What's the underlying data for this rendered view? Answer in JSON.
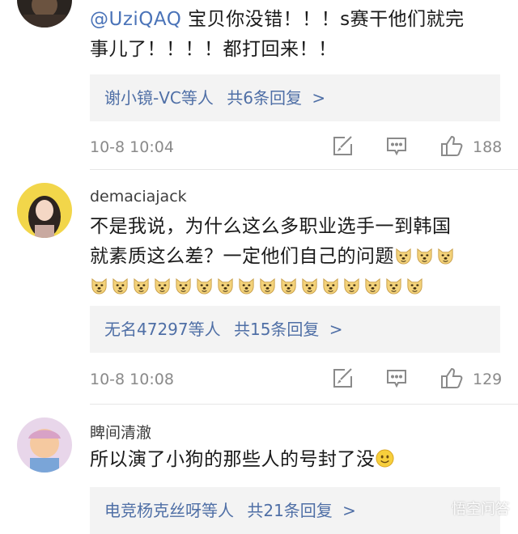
{
  "comments": [
    {
      "mention": "@UziQAQ",
      "text_line1_rest": " 宝贝你没错！！！s赛干他们就完",
      "text_line2": "事儿了！！！！都打回来！！",
      "replies": {
        "users": "谢小镜-VC等人",
        "total": "共6条回复",
        "chevron": ">"
      },
      "timestamp": "10-8 10:04",
      "likes": "188"
    },
    {
      "username": "demaciajack",
      "text_line1": "不是我说，为什么这么多职业选手一到韩国",
      "text_line2": "就素质这么差？一定他们自己的问题",
      "replies": {
        "users": "无名47297等人",
        "total": "共15条回复",
        "chevron": ">"
      },
      "timestamp": "10-8 10:08",
      "likes": "129"
    },
    {
      "username": "睥间清澈",
      "text_line1": "所以演了小狗的那些人的号封了没",
      "replies": {
        "users": "电竞杨克丝呀等人",
        "total": "共21条回复",
        "chevron": ">"
      }
    }
  ],
  "watermark": "悟空问答",
  "icons": {
    "edit": "edit-icon",
    "comment": "comment-icon",
    "like": "thumbs-up-icon",
    "emoji_doge": "doge-emoji",
    "emoji_smile": "smile-emoji"
  },
  "colors": {
    "link": "#4a73b8",
    "reply_text": "#4f6fa6",
    "reply_bg": "#f3f3f3",
    "meta": "#8a8a8a"
  }
}
